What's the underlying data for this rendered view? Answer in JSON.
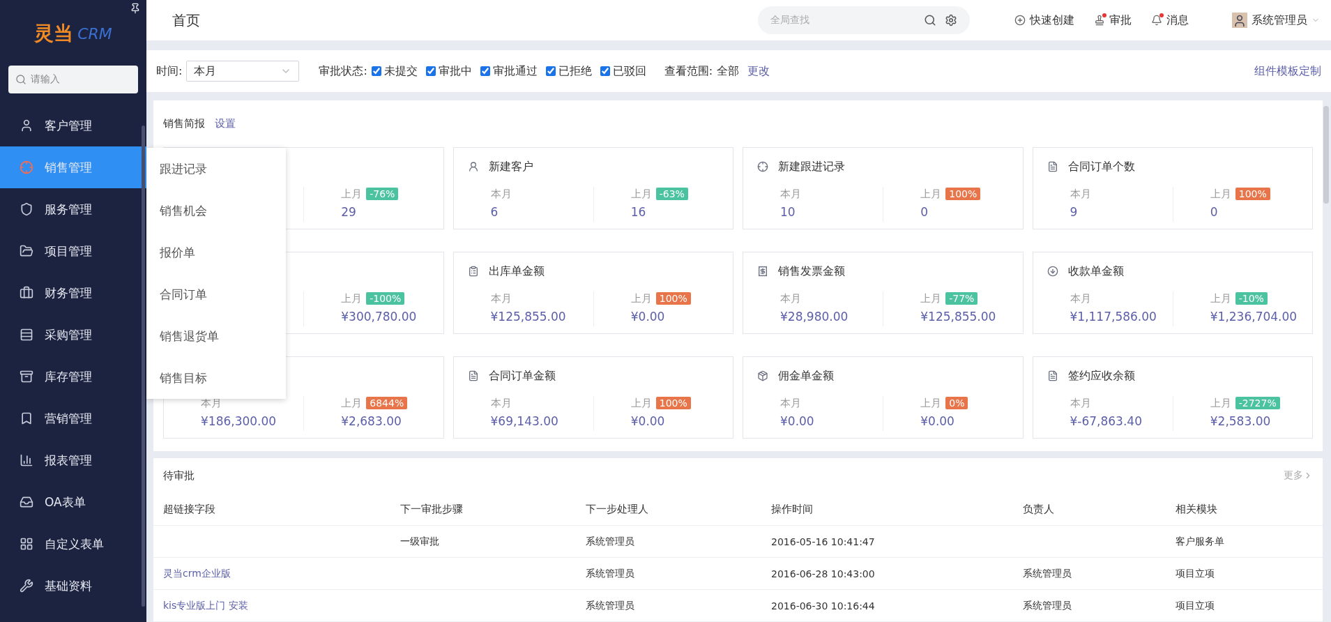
{
  "sidebar": {
    "logo": {
      "mark": "灵当",
      "product": "CRM"
    },
    "search": {
      "placeholder": "请输入"
    },
    "items": [
      {
        "label": "客户管理",
        "selected": false
      },
      {
        "label": "销售管理",
        "selected": true
      },
      {
        "label": "服务管理",
        "selected": false
      },
      {
        "label": "项目管理",
        "selected": false
      },
      {
        "label": "财务管理",
        "selected": false
      },
      {
        "label": "采购管理",
        "selected": false
      },
      {
        "label": "库存管理",
        "selected": false
      },
      {
        "label": "营销管理",
        "selected": false
      },
      {
        "label": "报表管理",
        "selected": false
      },
      {
        "label": "OA表单",
        "selected": false
      },
      {
        "label": "自定义表单",
        "selected": false
      },
      {
        "label": "基础资料",
        "selected": false
      }
    ]
  },
  "submenu": [
    "跟进记录",
    "销售机会",
    "报价单",
    "合同订单",
    "销售退货单",
    "销售目标"
  ],
  "header": {
    "title": "首页",
    "search": {
      "placeholder": "全局查找"
    },
    "actions": [
      {
        "label": "快速创建",
        "kind": "create",
        "alert": false
      },
      {
        "label": "审批",
        "kind": "approve",
        "alert": true
      },
      {
        "label": "消息",
        "kind": "message",
        "alert": true
      }
    ],
    "user": "系统管理员"
  },
  "filters": {
    "time_label": "时间:",
    "time_value": "本月",
    "status_label": "审批状态:",
    "statuses": [
      {
        "label": "未提交",
        "checked": true
      },
      {
        "label": "审批中",
        "checked": true
      },
      {
        "label": "审批通过",
        "checked": true
      },
      {
        "label": "已拒绝",
        "checked": true
      },
      {
        "label": "已驳回",
        "checked": true
      }
    ],
    "scope_label": "查看范围:",
    "scope_value": "全部",
    "scope_link": "更改",
    "customize_link": "组件模板定制"
  },
  "sales_report": {
    "title": "销售简报",
    "settings_link": "设置",
    "cards": [
      {
        "last_label": "上月",
        "change": "-76%",
        "color": "#4cc3a0",
        "last_value": "29"
      },
      {
        "title": "新建客户",
        "this_label": "本月",
        "this_value": "6",
        "last_label": "上月",
        "change": "-63%",
        "color": "#4cc3a0",
        "last_value": "16"
      },
      {
        "title": "新建跟进记录",
        "this_label": "本月",
        "this_value": "10",
        "last_label": "上月",
        "change": "100%",
        "color": "#e8754a",
        "last_value": "0"
      },
      {
        "title": "合同订单个数",
        "this_label": "本月",
        "this_value": "9",
        "last_label": "上月",
        "change": "100%",
        "color": "#e8754a",
        "last_value": "0"
      },
      {
        "last_label": "上月",
        "change": "-100%",
        "color": "#4cc3a0",
        "last_value": "¥300,780.00"
      },
      {
        "title": "出库单金额",
        "this_label": "本月",
        "this_value": "¥125,855.00",
        "last_label": "上月",
        "change": "100%",
        "color": "#e8754a",
        "last_value": "¥0.00"
      },
      {
        "title": "销售发票金额",
        "this_label": "本月",
        "this_value": "¥28,980.00",
        "last_label": "上月",
        "change": "-77%",
        "color": "#4cc3a0",
        "last_value": "¥125,855.00"
      },
      {
        "title": "收款单金额",
        "this_label": "本月",
        "this_value": "¥1,117,586.00",
        "last_label": "上月",
        "change": "-10%",
        "color": "#4cc3a0",
        "last_value": "¥1,236,704.00"
      },
      {
        "this_label": "本月",
        "this_value": "¥186,300.00",
        "last_label": "上月",
        "change": "6844%",
        "color": "#e8754a",
        "last_value": "¥2,683.00"
      },
      {
        "title": "合同订单金额",
        "this_label": "本月",
        "this_value": "¥69,143.00",
        "last_label": "上月",
        "change": "100%",
        "color": "#e8754a",
        "last_value": "¥0.00"
      },
      {
        "title": "佣金单金额",
        "this_label": "本月",
        "this_value": "¥0.00",
        "last_label": "上月",
        "change": "0%",
        "color": "#e8754a",
        "last_value": "¥0.00"
      },
      {
        "title": "签约应收余额",
        "this_label": "本月",
        "this_value": "¥-67,863.40",
        "last_label": "上月",
        "change": "-2727%",
        "color": "#4cc3a0",
        "last_value": "¥2,583.00"
      }
    ]
  },
  "pending": {
    "title": "待审批",
    "more_link": "更多",
    "columns": [
      "超链接字段",
      "下一审批步骤",
      "下一步处理人",
      "操作时间",
      "负责人",
      "相关模块"
    ],
    "rows": [
      [
        "",
        "一级审批",
        "系统管理员",
        "2016-05-16 10:41:47",
        "",
        "客户服务单"
      ],
      [
        "灵当crm企业版",
        "",
        "系统管理员",
        "2016-06-28 10:43:00",
        "系统管理员",
        "项目立项"
      ],
      [
        "kis专业版上门 安装",
        "",
        "系统管理员",
        "2016-06-30 10:16:44",
        "系统管理员",
        "项目立项"
      ]
    ]
  }
}
